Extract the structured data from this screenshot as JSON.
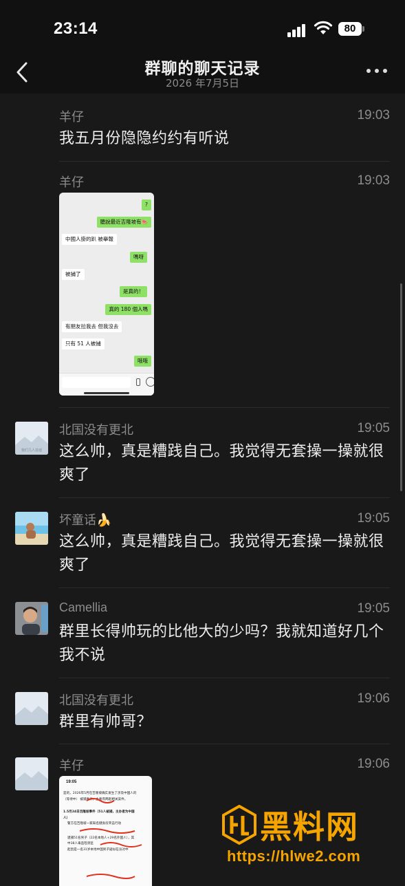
{
  "status": {
    "time": "23:14",
    "battery": "80"
  },
  "nav": {
    "title": "群聊的聊天记录",
    "subtitle": "2026 年7月5日"
  },
  "messages": [
    {
      "sender": "羊仔",
      "time": "19:03",
      "text": "我五月份隐隐约约有听说"
    },
    {
      "sender": "羊仔",
      "time": "19:03",
      "text": ""
    },
    {
      "sender": "北国没有更北",
      "time": "19:05",
      "text": "这么帅，真是糟践自己。我觉得无套操一操就很爽了"
    },
    {
      "sender": "坏童话🍌",
      "time": "19:05",
      "text": "这么帅，真是糟践自己。我觉得无套操一操就很爽了"
    },
    {
      "sender": "Camellia",
      "time": "19:05",
      "text": "群里长得帅玩的比他大的少吗？我就知道好几个我不说"
    },
    {
      "sender": "北国没有更北",
      "time": "19:06",
      "text": "群里有帅哥？"
    },
    {
      "sender": "羊仔",
      "time": "19:06",
      "text": ""
    }
  ],
  "shot1": {
    "bubbles": [
      {
        "text": "?",
        "side": "right"
      },
      {
        "text": "聽說最近吉隆坡有🍉",
        "side": "right"
      },
      {
        "text": "中國人掛的趴 被舉報",
        "side": "left"
      },
      {
        "text": "嗎呀",
        "side": "right"
      },
      {
        "text": "被捕了",
        "side": "left"
      },
      {
        "text": "是真的！",
        "side": "right"
      },
      {
        "text": "真的 180 個人嗎",
        "side": "right"
      },
      {
        "text": "有朋友拉我去 但我沒去",
        "side": "left"
      },
      {
        "text": "只有 51 人被捕",
        "side": "left"
      },
      {
        "text": "哦哦",
        "side": "right"
      }
    ]
  },
  "shot2": {
    "status_time": "19:05",
    "lines": [
      "是的，2026年5月在吉隆坡确实发生了涉及中国人的",
      "（等待中） 被捕事件，主要有两起相关案件。",
      "1.5月24日吉隆坡事件（51人被捕，主办者为中国",
      "人）",
      "警方在吉隆坡一家知名健身房突击行动",
      "逮捕51名男子（22名本地人+29名外国人），其",
      "中38人毒品检测呈",
      "起因是一名31岁本地中国男子疑似在派对中"
    ],
    "avatar_label": "我们几人造谣"
  },
  "watermark": {
    "brand": "黑料网",
    "url": "https://hlwe2.com"
  },
  "colors": {
    "background": "#191919",
    "bar": "#111111",
    "green_bubble": "#8fe067",
    "watermark": "#f5a400"
  }
}
